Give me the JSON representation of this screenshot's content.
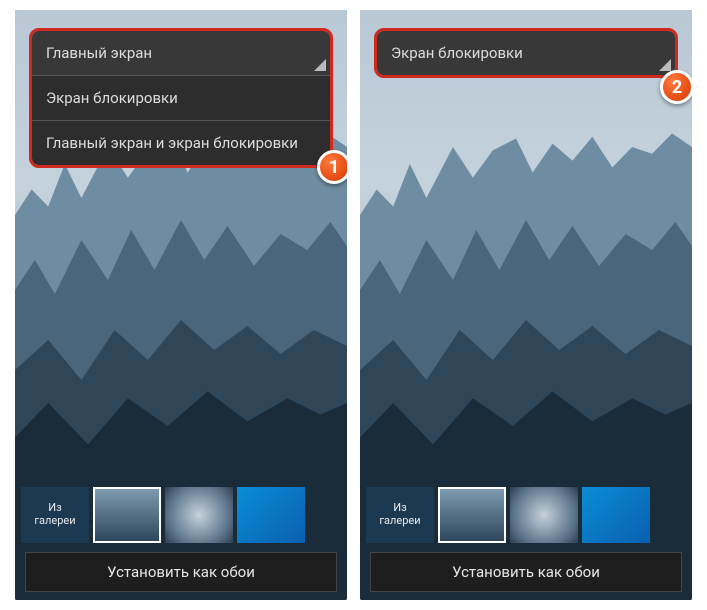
{
  "left": {
    "dropdown": {
      "items": [
        "Главный экран",
        "Экран блокировки",
        "Главный экран и экран блокировки"
      ]
    },
    "gallery_label_1": "Из",
    "gallery_label_2": "галереи",
    "set_button": "Установить как обои",
    "badge": "1"
  },
  "right": {
    "dropdown": {
      "selected": "Экран блокировки"
    },
    "gallery_label_1": "Из",
    "gallery_label_2": "галереи",
    "set_button": "Установить как обои",
    "badge": "2"
  }
}
